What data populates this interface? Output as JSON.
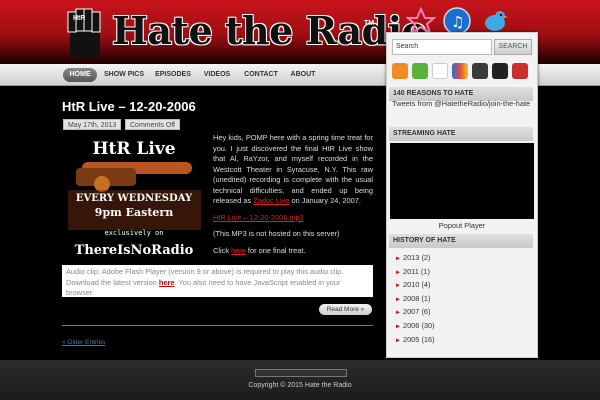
{
  "header": {
    "site_title": "Hate the Radio",
    "tm": "TM",
    "fist_text": "HtR"
  },
  "social": [
    {
      "icon": "myspace-star-icon"
    },
    {
      "icon": "itunes-icon"
    },
    {
      "icon": "twitter-bird-icon"
    }
  ],
  "nav": [
    {
      "label": "HOME",
      "active": true
    },
    {
      "label": "SHOW PICS"
    },
    {
      "label": "EPISODES"
    },
    {
      "label": "VIDEOS"
    },
    {
      "label": "CONTACT"
    },
    {
      "label": "ABOUT"
    }
  ],
  "post": {
    "title": "HtR Live – 12-20-2006",
    "date": "May 17th, 2013",
    "comments": "Comments Off",
    "image": {
      "line1": "HtR Live",
      "line2": "EVERY WEDNESDAY",
      "line3": "9pm Eastern",
      "line4": "exclusively on",
      "line5": "ThereIsNoRadio"
    },
    "para1_a": "Hey kids, POMP here with a spring time treat for you. I just discovered the final HtR Live show that Al, RaYzor, and myself recorded in the Westcott Theater in Syracuse, N.Y. This raw (unedited) recording is complete with the usual technical difficulties, and ended up being released as ",
    "para1_link": "Zadoc Live",
    "para1_b": " on January 24, 2007.",
    "mp3_link": "HtR Live – 12-20-2006.mp3",
    "para2": "(This MP3 is not hosted on this server)",
    "para3_a": "Click ",
    "para3_link": "here",
    "para3_b": " for one final treat.",
    "flash_a": "Audio clip: Adobe Flash Player (version 9 or above) is required to play this audio clip. Download the latest version ",
    "flash_link": "here",
    "flash_b": ". You also need to have JavaScript enabled in your browser.",
    "read_more": "Read More »"
  },
  "older_entries": "« Older Entries",
  "sidebar": {
    "search_placeholder": "Search",
    "search_button": "SEARCH",
    "feed_icons": [
      "rss-icon",
      "plus-icon",
      "youtube-icon",
      "myspace-icon",
      "grid-icon",
      "app-icon",
      "stumble-icon"
    ],
    "reasons_title": "140 REASONS TO HATE",
    "tweets_text": "Tweets from @HatetheRadio/join-the-hate",
    "streaming_title": "STREAMING HATE",
    "popout": "Popout Player",
    "history_title": "HISTORY OF HATE",
    "archive": [
      {
        "label": "2013 (2)"
      },
      {
        "label": "2011 (1)"
      },
      {
        "label": "2010 (4)"
      },
      {
        "label": "2008 (1)"
      },
      {
        "label": "2007 (6)"
      },
      {
        "label": "2006 (30)"
      },
      {
        "label": "2005 (16)"
      }
    ]
  },
  "footer": {
    "copyright": "Copyright © 2015 Hate the Radio"
  }
}
